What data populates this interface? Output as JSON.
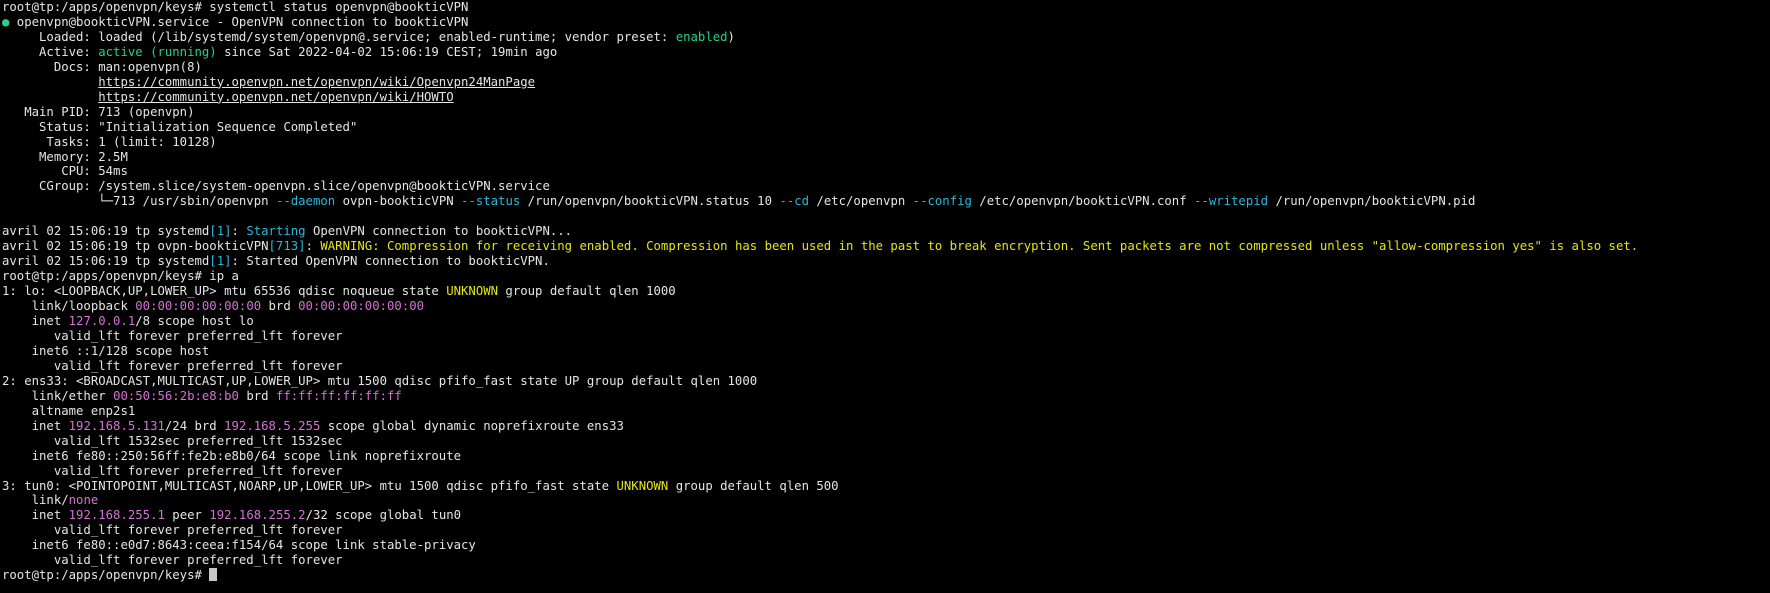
{
  "colors": {
    "default": "#e5e5e5",
    "green": "#23d18b",
    "cyan": "#29b8db",
    "magenta": "#d670d6",
    "yellow": "#e5e510",
    "background": "#000000",
    "cursor": "#c8c8c8"
  },
  "terminal": {
    "lines": [
      [
        {
          "t": "root@tp:/apps/openvpn/keys# systemctl status openvpn@bookticVPN"
        }
      ],
      [
        {
          "t": "●",
          "c": "green"
        },
        {
          "t": " openvpn@bookticVPN.service - OpenVPN connection to bookticVPN"
        }
      ],
      [
        {
          "t": "     Loaded: loaded (/lib/systemd/system/openvpn@.service; enabled-runtime; vendor preset: "
        },
        {
          "t": "enabled",
          "c": "green"
        },
        {
          "t": ")"
        }
      ],
      [
        {
          "t": "     Active: "
        },
        {
          "t": "active (running)",
          "c": "green"
        },
        {
          "t": " since Sat 2022-04-02 15:06:19 CEST; 19min ago"
        }
      ],
      [
        {
          "t": "       Docs: man:openvpn(8)"
        }
      ],
      [
        {
          "t": "             "
        },
        {
          "t": "https://community.openvpn.net/openvpn/wiki/Openvpn24ManPage",
          "u": true
        }
      ],
      [
        {
          "t": "             "
        },
        {
          "t": "https://community.openvpn.net/openvpn/wiki/HOWTO",
          "u": true
        }
      ],
      [
        {
          "t": "   Main PID: 713 (openvpn)"
        }
      ],
      [
        {
          "t": "     Status: \"Initialization Sequence Completed\""
        }
      ],
      [
        {
          "t": "      Tasks: 1 (limit: 10128)"
        }
      ],
      [
        {
          "t": "     Memory: 2.5M"
        }
      ],
      [
        {
          "t": "        CPU: 54ms"
        }
      ],
      [
        {
          "t": "     CGroup: /system.slice/system-openvpn.slice/openvpn@bookticVPN.service"
        }
      ],
      [
        {
          "t": "             └─713 /usr/sbin/openvpn "
        },
        {
          "t": "--daemon",
          "c": "cyan"
        },
        {
          "t": " ovpn-bookticVPN "
        },
        {
          "t": "--status",
          "c": "cyan"
        },
        {
          "t": " /run/openvpn/bookticVPN.status 10 "
        },
        {
          "t": "--cd",
          "c": "cyan"
        },
        {
          "t": " /etc/openvpn "
        },
        {
          "t": "--config",
          "c": "cyan"
        },
        {
          "t": " /etc/openvpn/bookticVPN.conf "
        },
        {
          "t": "--writepid",
          "c": "cyan"
        },
        {
          "t": " /run/openvpn/bookticVPN.pid"
        }
      ],
      [
        {
          "t": ""
        }
      ],
      [
        {
          "t": "avril 02 15:06:19 tp systemd"
        },
        {
          "t": "[1]",
          "c": "cyan"
        },
        {
          "t": ": "
        },
        {
          "t": "Starting",
          "c": "cyan"
        },
        {
          "t": " OpenVPN connection to bookticVPN..."
        }
      ],
      [
        {
          "t": "avril 02 15:06:19 tp ovpn-bookticVPN"
        },
        {
          "t": "[713]",
          "c": "cyan"
        },
        {
          "t": ": "
        },
        {
          "t": "WARNING: Compression for receiving enabled. Compression has been used in the past to break encryption. Sent packets are not compressed unless \"allow-compression yes\" is also set.",
          "c": "yellow"
        }
      ],
      [
        {
          "t": "avril 02 15:06:19 tp systemd"
        },
        {
          "t": "[1]",
          "c": "cyan"
        },
        {
          "t": ": Started OpenVPN connection to bookticVPN."
        }
      ],
      [
        {
          "t": "root@tp:/apps/openvpn/keys# ip a"
        }
      ],
      [
        {
          "t": "1: lo: <LOOPBACK,UP,LOWER_UP> mtu 65536 qdisc noqueue state "
        },
        {
          "t": "UNKNOWN",
          "c": "yellow"
        },
        {
          "t": " group default qlen 1000"
        }
      ],
      [
        {
          "t": "    link/loopback "
        },
        {
          "t": "00:00:00:00:00:00",
          "c": "magenta"
        },
        {
          "t": " brd "
        },
        {
          "t": "00:00:00:00:00:00",
          "c": "magenta"
        }
      ],
      [
        {
          "t": "    inet "
        },
        {
          "t": "127.0.0.1",
          "c": "magenta"
        },
        {
          "t": "/8 scope host lo"
        }
      ],
      [
        {
          "t": "       valid_lft forever preferred_lft forever"
        }
      ],
      [
        {
          "t": "    inet6 ::1/128 scope host"
        }
      ],
      [
        {
          "t": "       valid_lft forever preferred_lft forever"
        }
      ],
      [
        {
          "t": "2: ens33: <BROADCAST,MULTICAST,UP,LOWER_UP> mtu 1500 qdisc pfifo_fast state UP group default qlen 1000"
        }
      ],
      [
        {
          "t": "    link/ether "
        },
        {
          "t": "00:50:56:2b:e8:b0",
          "c": "magenta"
        },
        {
          "t": " brd "
        },
        {
          "t": "ff:ff:ff:ff:ff:ff",
          "c": "magenta"
        }
      ],
      [
        {
          "t": "    altname enp2s1"
        }
      ],
      [
        {
          "t": "    inet "
        },
        {
          "t": "192.168.5.131",
          "c": "magenta"
        },
        {
          "t": "/24 brd "
        },
        {
          "t": "192.168.5.255",
          "c": "magenta"
        },
        {
          "t": " scope global dynamic noprefixroute ens33"
        }
      ],
      [
        {
          "t": "       valid_lft 1532sec preferred_lft 1532sec"
        }
      ],
      [
        {
          "t": "    inet6 fe80::250:56ff:fe2b:e8b0/64 scope link noprefixroute"
        }
      ],
      [
        {
          "t": "       valid_lft forever preferred_lft forever"
        }
      ],
      [
        {
          "t": "3: tun0: <POINTOPOINT,MULTICAST,NOARP,UP,LOWER_UP> mtu 1500 qdisc pfifo_fast state "
        },
        {
          "t": "UNKNOWN",
          "c": "yellow"
        },
        {
          "t": " group default qlen 500"
        }
      ],
      [
        {
          "t": "    link/"
        },
        {
          "t": "none",
          "c": "magenta"
        }
      ],
      [
        {
          "t": "    inet "
        },
        {
          "t": "192.168.255.1",
          "c": "magenta"
        },
        {
          "t": " peer "
        },
        {
          "t": "192.168.255.2",
          "c": "magenta"
        },
        {
          "t": "/32 scope global tun0"
        }
      ],
      [
        {
          "t": "       valid_lft forever preferred_lft forever"
        }
      ],
      [
        {
          "t": "    inet6 fe80::e0d7:8643:ceea:f154/64 scope link stable-privacy"
        }
      ],
      [
        {
          "t": "       valid_lft forever preferred_lft forever"
        }
      ],
      [
        {
          "t": "root@tp:/apps/openvpn/keys# "
        }
      ]
    ]
  }
}
